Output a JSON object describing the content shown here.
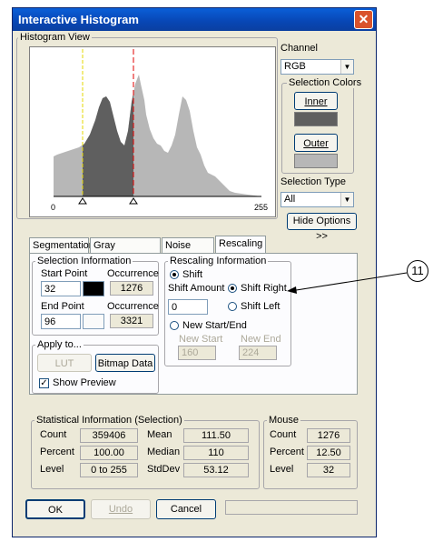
{
  "window": {
    "title": "Interactive Histogram",
    "close_glyph": "✕"
  },
  "histogram_view": {
    "label": "Histogram View",
    "axis_min": "0",
    "axis_max": "255"
  },
  "channel": {
    "label": "Channel",
    "value": "RGB"
  },
  "selection_colors": {
    "label": "Selection Colors",
    "inner_button": "Inner",
    "outer_button": "Outer",
    "inner_color": "#5f5f5f",
    "outer_color": "#b7b7b7"
  },
  "selection_type": {
    "label": "Selection Type",
    "value": "All"
  },
  "hide_options_button": "Hide Options >>",
  "tabs": [
    {
      "label": "Segmentation"
    },
    {
      "label": "Gray Distribution"
    },
    {
      "label": "Noise Filter"
    },
    {
      "label": "Rescaling"
    }
  ],
  "selection_info": {
    "label": "Selection Information",
    "start_point_label": "Start Point",
    "start_point_value": "32",
    "start_occurrence_label": "Occurrence",
    "start_occurrence_value": "1276",
    "end_point_label": "End Point",
    "end_point_value": "96",
    "end_occurrence_label": "Occurrence",
    "end_occurrence_value": "3321"
  },
  "apply_to": {
    "label": "Apply to...",
    "lut_button": "LUT",
    "bitmap_button": "Bitmap Data",
    "show_preview_label": "Show Preview",
    "show_preview_checked": true
  },
  "rescaling_info": {
    "label": "Rescaling Information",
    "shift_label": "Shift",
    "shift_amount_label": "Shift Amount",
    "shift_amount_value": "0",
    "shift_right_label": "Shift Right",
    "shift_left_label": "Shift Left",
    "new_start_end_label": "New Start/End",
    "new_start_label": "New Start",
    "new_start_value": "160",
    "new_end_label": "New End",
    "new_end_value": "224"
  },
  "stats": {
    "label": "Statistical Information (Selection)",
    "count_label": "Count",
    "count_value": "359406",
    "percent_label": "Percent",
    "percent_value": "100.00",
    "level_label": "Level",
    "level_value": "0 to 255",
    "mean_label": "Mean",
    "mean_value": "111.50",
    "median_label": "Median",
    "median_value": "110",
    "stddev_label": "StdDev",
    "stddev_value": "53.12"
  },
  "mouse": {
    "label": "Mouse",
    "count_label": "Count",
    "count_value": "1276",
    "percent_label": "Percent",
    "percent_value": "12.50",
    "level_label": "Level",
    "level_value": "32"
  },
  "buttons": {
    "ok": "OK",
    "undo": "Undo",
    "cancel": "Cancel"
  },
  "callout": {
    "number": "11"
  }
}
